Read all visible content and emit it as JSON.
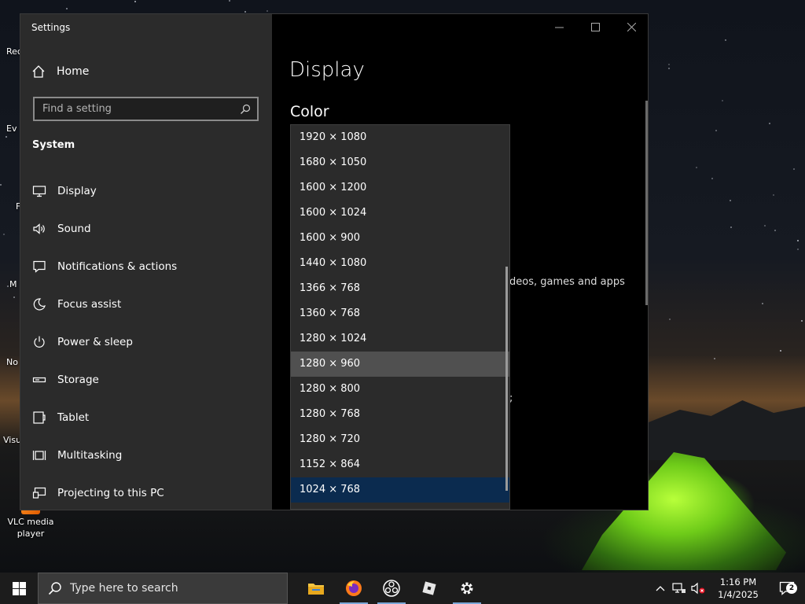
{
  "desktop": {
    "icons": [
      {
        "label": "VLC media player"
      }
    ],
    "partial_labels": [
      "Rec",
      "Ev",
      "F",
      "M",
      "No",
      "Visu"
    ]
  },
  "window": {
    "title": "Settings",
    "sidebar": {
      "home_label": "Home",
      "search_placeholder": "Find a setting",
      "section_title": "System",
      "items": [
        {
          "label": "Display",
          "icon": "monitor-icon"
        },
        {
          "label": "Sound",
          "icon": "speaker-icon"
        },
        {
          "label": "Notifications & actions",
          "icon": "notification-icon"
        },
        {
          "label": "Focus assist",
          "icon": "moon-icon"
        },
        {
          "label": "Power & sleep",
          "icon": "power-icon"
        },
        {
          "label": "Storage",
          "icon": "storage-icon"
        },
        {
          "label": "Tablet",
          "icon": "tablet-icon"
        },
        {
          "label": "Multitasking",
          "icon": "multitasking-icon"
        },
        {
          "label": "Projecting to this PC",
          "icon": "projecting-icon"
        }
      ]
    },
    "content": {
      "page_title": "Display",
      "color_heading": "Color",
      "background_text": "deos, games and apps",
      "background_semicolon": ";"
    }
  },
  "resolution_dropdown": {
    "options": [
      "1920 × 1080",
      "1680 × 1050",
      "1600 × 1200",
      "1600 × 1024",
      "1600 × 900",
      "1440 × 1080",
      "1366 × 768",
      "1360 × 768",
      "1280 × 1024",
      "1280 × 960",
      "1280 × 800",
      "1280 × 768",
      "1280 × 720",
      "1152 × 864",
      "1024 × 768"
    ],
    "hovered": "1280 × 960",
    "selected": "1024 × 768",
    "hover_color": "#505050",
    "selected_color": "#0b2b4f"
  },
  "taskbar": {
    "search_placeholder": "Type here to search",
    "apps": [
      "file-explorer-icon",
      "firefox-icon",
      "obs-icon",
      "roblox-icon",
      "settings-gear-icon"
    ],
    "clock_time": "1:16 PM",
    "clock_date": "1/4/2025",
    "notification_count": "2"
  }
}
